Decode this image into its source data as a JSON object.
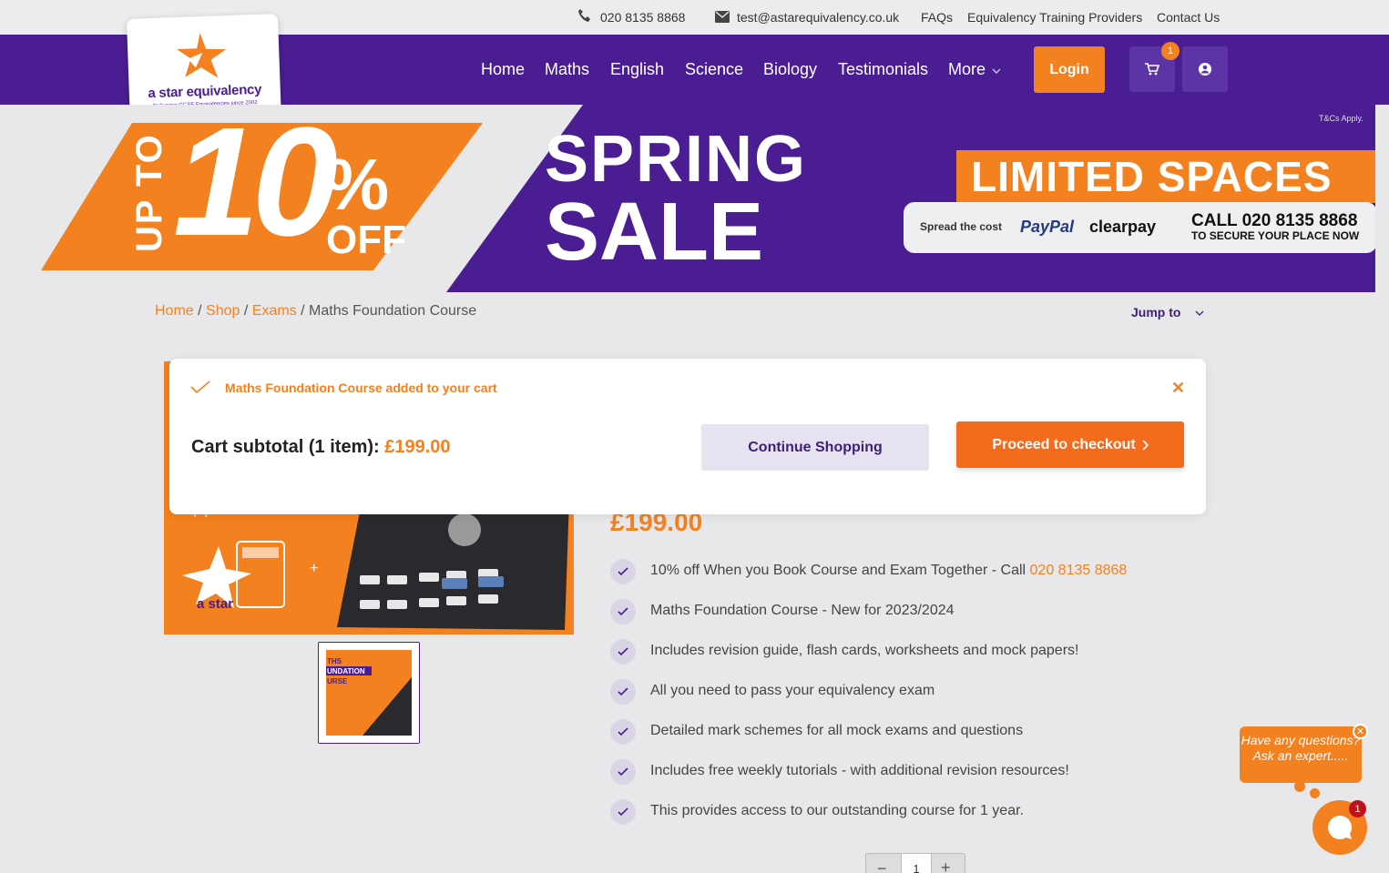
{
  "topbar": {
    "phone": "020 8135 8868",
    "email": "test@astarequivalency.co.uk",
    "links": [
      "FAQs",
      "Equivalency Training Providers",
      "Contact Us"
    ]
  },
  "logo": {
    "name": "a star equivalency",
    "tagline": "Delivering GCSE Equivalencies since 2002"
  },
  "nav": {
    "links": [
      "Home",
      "Maths",
      "English",
      "Science",
      "Biology",
      "Testimonials",
      "More"
    ],
    "login": "Login",
    "cart_count": "1"
  },
  "banner": {
    "up_to": "UP TO",
    "number": "10",
    "percent": "%",
    "off": "OFF",
    "spring": "SPRING",
    "sale": "SALE",
    "tcs": "T&Cs Apply.",
    "limited": "LIMITED SPACES",
    "spread": "Spread the cost",
    "paypal": "PayPal",
    "clearpay": "clearpay",
    "call": "CALL 020 8135 8868",
    "secure": "TO SECURE YOUR PLACE NOW"
  },
  "breadcrumb": {
    "items": [
      "Home",
      "Shop",
      "Exams"
    ],
    "current": "Maths Foundation Course",
    "sep": "/"
  },
  "jump_to": "Jump to",
  "modal": {
    "added": "Maths Foundation Course added to your cart",
    "subtotal_label": "Cart subtotal (1 item):",
    "subtotal_amount": "£199.00",
    "continue": "Continue Shopping",
    "checkout": "Proceed to checkout"
  },
  "product": {
    "price": "£199.00",
    "image_text": "a star",
    "thumb_text": [
      "THS",
      "UNDATION",
      "URSE"
    ],
    "bullets": [
      {
        "text": "10% off When you Book Course and Exam Together - Call ",
        "link": "020 8135 8868"
      },
      {
        "text": "Maths Foundation Course - New for 2023/2024"
      },
      {
        "text": "Includes revision guide, flash cards, worksheets and mock papers!"
      },
      {
        "text": "All you need to pass your equivalency exam"
      },
      {
        "text": "Detailed mark schemes for all mock exams and questions"
      },
      {
        "text": "Includes free weekly tutorials - with additional revision resources!"
      },
      {
        "text": "This provides access to our outstanding course for 1 year."
      }
    ],
    "quantity": "1"
  },
  "chat": {
    "prompt": "Have any questions? Ask an expert.....",
    "badge": "1"
  },
  "colors": {
    "purple": "#4b1d92",
    "orange": "#f48120",
    "background": "#e8e8ea"
  }
}
